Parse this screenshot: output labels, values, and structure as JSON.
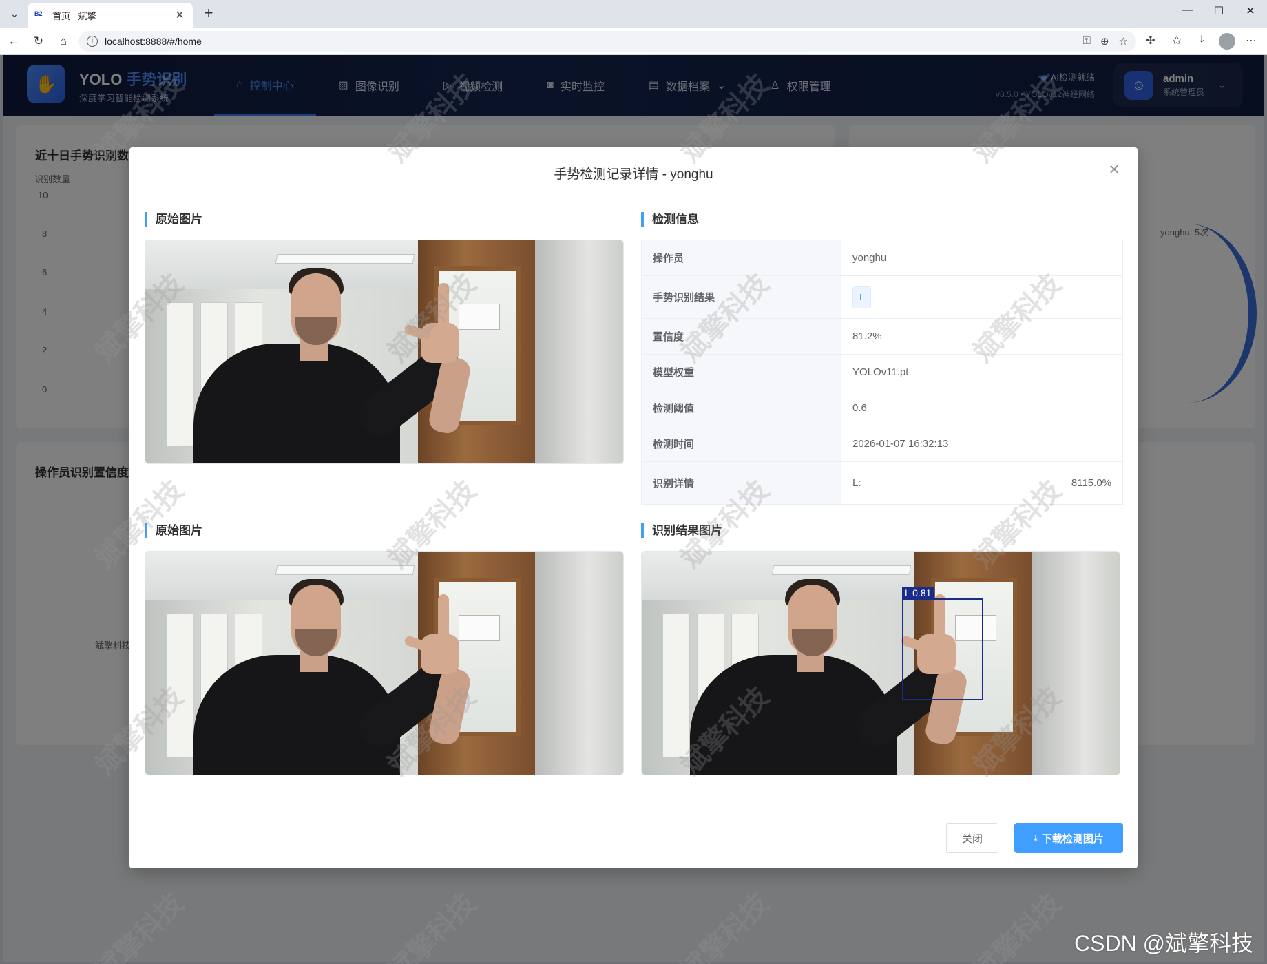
{
  "browser": {
    "tab_title": "首页 - 斌擎",
    "favicon_text": "B2",
    "url": "localhost:8888/#/home"
  },
  "app": {
    "brand_prefix": "YOLO",
    "brand_highlight": "手势识别",
    "brand_sub": "深度学习智能检测系统",
    "menu": [
      {
        "label": "控制中心",
        "icon": "home-icon",
        "active": true
      },
      {
        "label": "图像识别",
        "icon": "image-icon"
      },
      {
        "label": "视频检测",
        "icon": "play-icon"
      },
      {
        "label": "实时监控",
        "icon": "camera-icon"
      },
      {
        "label": "数据档案",
        "icon": "document-icon",
        "has_dropdown": true
      },
      {
        "label": "权限管理",
        "icon": "user-icon"
      }
    ],
    "status_text": "AI检测就绪",
    "status_version": "v8.5.0 • YOLOv12神经网络",
    "user_name": "admin",
    "user_role": "系统管理员"
  },
  "dashboard": {
    "trend_card_title": "近十日手势识别数据趋势",
    "trend_y_axis_title": "识别数量",
    "trend_y_ticks": [
      "10",
      "8",
      "6",
      "4",
      "2",
      "0"
    ],
    "pie_legend": "yonghu: 5次",
    "conf_card_title": "操作员识别置信度分析",
    "conf_label": "斌擎科技"
  },
  "dialog": {
    "title": "手势检测记录详情 - yonghu",
    "original_image_title": "原始图片",
    "info_title": "检测信息",
    "original_image_title_2": "原始图片",
    "result_image_title": "识别结果图片",
    "detection_label": "L  0.81",
    "info": {
      "operator_label": "操作员",
      "operator_value": "yonghu",
      "result_label": "手势识别结果",
      "result_value": "L",
      "confidence_label": "置信度",
      "confidence_value": "81.2%",
      "model_label": "模型权重",
      "model_value": "YOLOv11.pt",
      "threshold_label": "检测阈值",
      "threshold_value": "0.6",
      "time_label": "检测时间",
      "time_value": "2026-01-07 16:32:13",
      "detail_label": "识别详情",
      "detail_class": "L:",
      "detail_value": "8115.0%"
    },
    "close_button": "关闭",
    "download_button": "下载检测图片"
  },
  "watermark_text": "斌擎科技",
  "csdn_text": "CSDN @斌擎科技"
}
